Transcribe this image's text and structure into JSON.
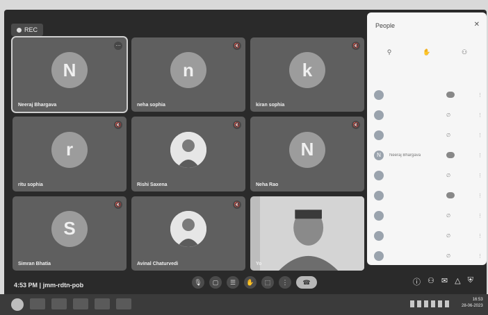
{
  "recording": {
    "label": "REC"
  },
  "tiles": [
    {
      "initial": "N",
      "name": "Neeraj Bhargava",
      "active": true
    },
    {
      "initial": "n",
      "name": "neha sophia"
    },
    {
      "initial": "k",
      "name": "kiran sophia"
    },
    {
      "initial": "r",
      "name": "ritu sophia"
    },
    {
      "initial": "",
      "name": "Rishi Saxena",
      "photo": true
    },
    {
      "initial": "N",
      "name": "Neha Rao"
    },
    {
      "initial": "S",
      "name": "Simran Bhatia"
    },
    {
      "initial": "",
      "name": "Avinal Chaturvedi",
      "photo": true
    },
    {
      "initial": "",
      "name": "Yo",
      "video": true
    }
  ],
  "people_panel": {
    "title": "People",
    "tabs": [
      "",
      "",
      ""
    ],
    "participants": [
      {
        "initial": "",
        "name": "",
        "badge": true
      },
      {
        "initial": "",
        "name": ""
      },
      {
        "initial": "",
        "name": ""
      },
      {
        "initial": "N",
        "name": "Neeraj Bhargava",
        "badge": true
      },
      {
        "initial": "",
        "name": ""
      },
      {
        "initial": "",
        "name": "",
        "badge": true
      },
      {
        "initial": "",
        "name": ""
      },
      {
        "initial": "",
        "name": ""
      },
      {
        "initial": "",
        "name": ""
      }
    ]
  },
  "meeting": {
    "time": "4:53 PM",
    "separator": "|",
    "code": "jmm-rdtn-pob"
  },
  "taskbar": {
    "time": "16:53",
    "date": "28-06-2023"
  }
}
